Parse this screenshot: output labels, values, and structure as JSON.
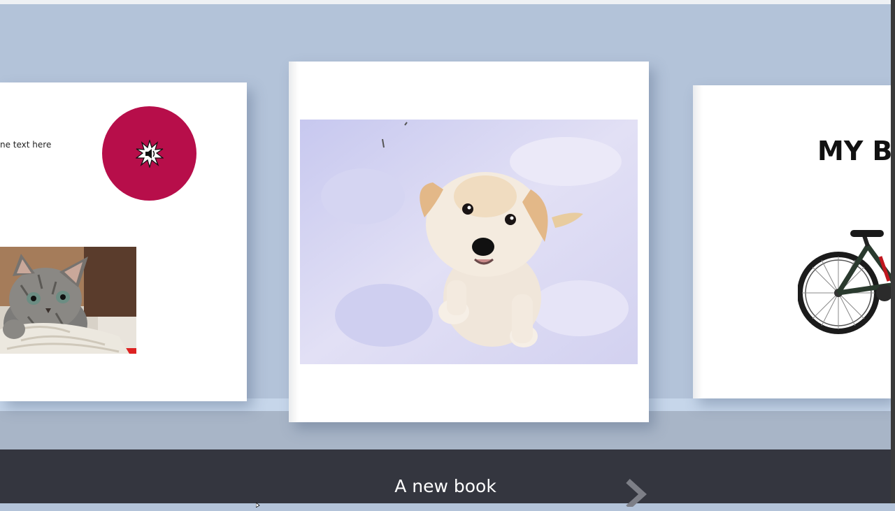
{
  "book": {
    "title": "A new book"
  },
  "pages": {
    "left": {
      "text_fragment": "ne text here",
      "audio_icon": "speaker-burst-icon",
      "image": "kitten"
    },
    "center": {
      "image": "puppy-in-snow"
    },
    "right": {
      "title_fragment": "MY BI",
      "image": "bicycle"
    }
  },
  "navigation": {
    "next_icon": "chevron-right-icon"
  },
  "colors": {
    "background": "#b3c3d9",
    "audio_button": "#b70e4a",
    "bottom_bar": "#34363f"
  }
}
